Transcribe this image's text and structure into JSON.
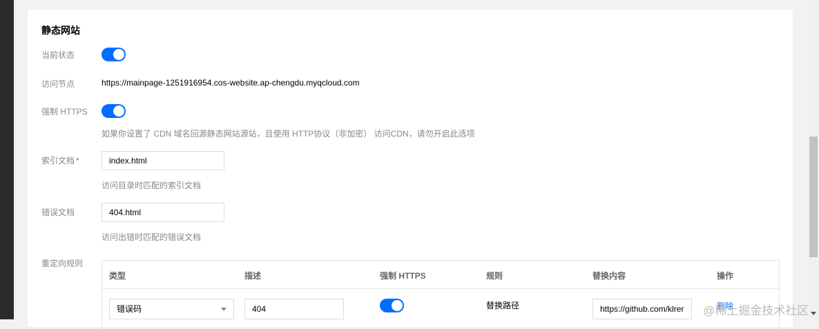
{
  "section": {
    "title": "静态网站"
  },
  "status": {
    "label": "当前状态",
    "on": true
  },
  "endpoint": {
    "label": "访问节点",
    "value": "https://mainpage-1251916954.cos-website.ap-chengdu.myqcloud.com"
  },
  "https": {
    "label": "强制 HTTPS",
    "on": true,
    "hint": "如果你设置了 CDN 域名回源静态网站源站，且使用 HTTP协议（非加密） 访问CDN，请勿开启此选项"
  },
  "index": {
    "label": "索引文档",
    "required_mark": "*",
    "value": "index.html",
    "hint": "访问目录时匹配的索引文档"
  },
  "error": {
    "label": "错误文档",
    "value": "404.html",
    "hint": "访问出错时匹配的错误文档"
  },
  "redirect": {
    "label": "重定向规则",
    "columns": [
      "类型",
      "描述",
      "强制 HTTPS",
      "规则",
      "替换内容",
      "操作"
    ],
    "rows": [
      {
        "type": "错误码",
        "desc": "404",
        "https_on": true,
        "rule": "替换路径",
        "replace": "https://github.com/klrer",
        "action": "删除"
      }
    ]
  },
  "watermark": "@稀土掘金技术社区",
  "colors": {
    "accent": "#006eff",
    "label": "#888888"
  }
}
